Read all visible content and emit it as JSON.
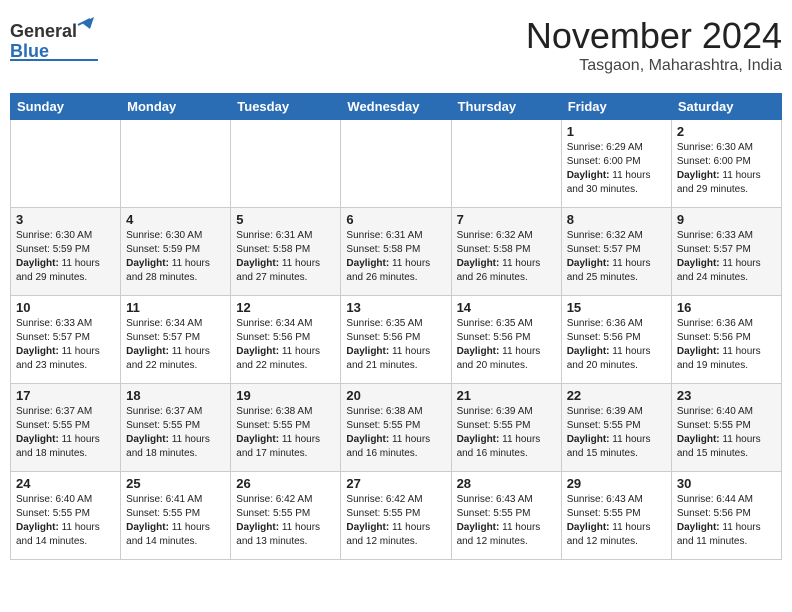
{
  "header": {
    "logo_general": "General",
    "logo_blue": "Blue",
    "month_title": "November 2024",
    "location": "Tasgaon, Maharashtra, India"
  },
  "weekdays": [
    "Sunday",
    "Monday",
    "Tuesday",
    "Wednesday",
    "Thursday",
    "Friday",
    "Saturday"
  ],
  "weeks": [
    [
      {
        "day": "",
        "info": ""
      },
      {
        "day": "",
        "info": ""
      },
      {
        "day": "",
        "info": ""
      },
      {
        "day": "",
        "info": ""
      },
      {
        "day": "",
        "info": ""
      },
      {
        "day": "1",
        "info": "Sunrise: 6:29 AM\nSunset: 6:00 PM\nDaylight: 11 hours and 30 minutes."
      },
      {
        "day": "2",
        "info": "Sunrise: 6:30 AM\nSunset: 6:00 PM\nDaylight: 11 hours and 29 minutes."
      }
    ],
    [
      {
        "day": "3",
        "info": "Sunrise: 6:30 AM\nSunset: 5:59 PM\nDaylight: 11 hours and 29 minutes."
      },
      {
        "day": "4",
        "info": "Sunrise: 6:30 AM\nSunset: 5:59 PM\nDaylight: 11 hours and 28 minutes."
      },
      {
        "day": "5",
        "info": "Sunrise: 6:31 AM\nSunset: 5:58 PM\nDaylight: 11 hours and 27 minutes."
      },
      {
        "day": "6",
        "info": "Sunrise: 6:31 AM\nSunset: 5:58 PM\nDaylight: 11 hours and 26 minutes."
      },
      {
        "day": "7",
        "info": "Sunrise: 6:32 AM\nSunset: 5:58 PM\nDaylight: 11 hours and 26 minutes."
      },
      {
        "day": "8",
        "info": "Sunrise: 6:32 AM\nSunset: 5:57 PM\nDaylight: 11 hours and 25 minutes."
      },
      {
        "day": "9",
        "info": "Sunrise: 6:33 AM\nSunset: 5:57 PM\nDaylight: 11 hours and 24 minutes."
      }
    ],
    [
      {
        "day": "10",
        "info": "Sunrise: 6:33 AM\nSunset: 5:57 PM\nDaylight: 11 hours and 23 minutes."
      },
      {
        "day": "11",
        "info": "Sunrise: 6:34 AM\nSunset: 5:57 PM\nDaylight: 11 hours and 22 minutes."
      },
      {
        "day": "12",
        "info": "Sunrise: 6:34 AM\nSunset: 5:56 PM\nDaylight: 11 hours and 22 minutes."
      },
      {
        "day": "13",
        "info": "Sunrise: 6:35 AM\nSunset: 5:56 PM\nDaylight: 11 hours and 21 minutes."
      },
      {
        "day": "14",
        "info": "Sunrise: 6:35 AM\nSunset: 5:56 PM\nDaylight: 11 hours and 20 minutes."
      },
      {
        "day": "15",
        "info": "Sunrise: 6:36 AM\nSunset: 5:56 PM\nDaylight: 11 hours and 20 minutes."
      },
      {
        "day": "16",
        "info": "Sunrise: 6:36 AM\nSunset: 5:56 PM\nDaylight: 11 hours and 19 minutes."
      }
    ],
    [
      {
        "day": "17",
        "info": "Sunrise: 6:37 AM\nSunset: 5:55 PM\nDaylight: 11 hours and 18 minutes."
      },
      {
        "day": "18",
        "info": "Sunrise: 6:37 AM\nSunset: 5:55 PM\nDaylight: 11 hours and 18 minutes."
      },
      {
        "day": "19",
        "info": "Sunrise: 6:38 AM\nSunset: 5:55 PM\nDaylight: 11 hours and 17 minutes."
      },
      {
        "day": "20",
        "info": "Sunrise: 6:38 AM\nSunset: 5:55 PM\nDaylight: 11 hours and 16 minutes."
      },
      {
        "day": "21",
        "info": "Sunrise: 6:39 AM\nSunset: 5:55 PM\nDaylight: 11 hours and 16 minutes."
      },
      {
        "day": "22",
        "info": "Sunrise: 6:39 AM\nSunset: 5:55 PM\nDaylight: 11 hours and 15 minutes."
      },
      {
        "day": "23",
        "info": "Sunrise: 6:40 AM\nSunset: 5:55 PM\nDaylight: 11 hours and 15 minutes."
      }
    ],
    [
      {
        "day": "24",
        "info": "Sunrise: 6:40 AM\nSunset: 5:55 PM\nDaylight: 11 hours and 14 minutes."
      },
      {
        "day": "25",
        "info": "Sunrise: 6:41 AM\nSunset: 5:55 PM\nDaylight: 11 hours and 14 minutes."
      },
      {
        "day": "26",
        "info": "Sunrise: 6:42 AM\nSunset: 5:55 PM\nDaylight: 11 hours and 13 minutes."
      },
      {
        "day": "27",
        "info": "Sunrise: 6:42 AM\nSunset: 5:55 PM\nDaylight: 11 hours and 12 minutes."
      },
      {
        "day": "28",
        "info": "Sunrise: 6:43 AM\nSunset: 5:55 PM\nDaylight: 11 hours and 12 minutes."
      },
      {
        "day": "29",
        "info": "Sunrise: 6:43 AM\nSunset: 5:55 PM\nDaylight: 11 hours and 12 minutes."
      },
      {
        "day": "30",
        "info": "Sunrise: 6:44 AM\nSunset: 5:56 PM\nDaylight: 11 hours and 11 minutes."
      }
    ]
  ]
}
